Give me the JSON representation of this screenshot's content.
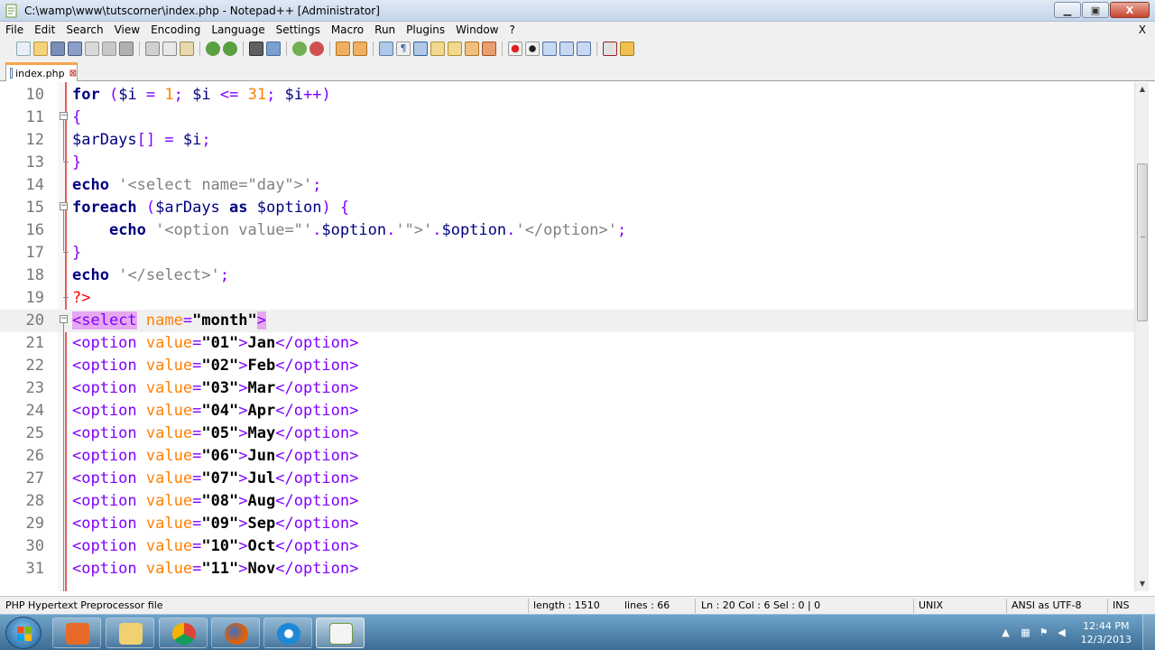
{
  "window": {
    "title": "C:\\wamp\\www\\tutscorner\\index.php - Notepad++ [Administrator]",
    "controls": {
      "minimize": "▁",
      "maximize": "▣",
      "close": "X"
    }
  },
  "menu": {
    "items": [
      "File",
      "Edit",
      "Search",
      "View",
      "Encoding",
      "Language",
      "Settings",
      "Macro",
      "Run",
      "Plugins",
      "Window",
      "?"
    ],
    "close_doc": "X"
  },
  "tab": {
    "label": "index.php",
    "close": "⊠"
  },
  "editor": {
    "lines": [
      {
        "n": "10"
      },
      {
        "n": "11"
      },
      {
        "n": "12"
      },
      {
        "n": "13"
      },
      {
        "n": "14"
      },
      {
        "n": "15"
      },
      {
        "n": "16"
      },
      {
        "n": "17"
      },
      {
        "n": "18"
      },
      {
        "n": "19"
      },
      {
        "n": "20"
      },
      {
        "n": "21"
      },
      {
        "n": "22"
      },
      {
        "n": "23"
      },
      {
        "n": "24"
      },
      {
        "n": "25"
      },
      {
        "n": "26"
      },
      {
        "n": "27"
      },
      {
        "n": "28"
      },
      {
        "n": "29"
      },
      {
        "n": "30"
      },
      {
        "n": "31"
      }
    ],
    "code": {
      "l10": {
        "kw": "for",
        "rest1": " (",
        "v": "$i",
        "op1": " = ",
        "num1": "1",
        "op2": "; ",
        "v2": "$i",
        "op3": " <= ",
        "num2": "31",
        "op4": "; ",
        "v3": "$i",
        "op5": "++)"
      },
      "l11": "{",
      "l12": {
        "v": "$arDays",
        "op": "[] = ",
        "v2": "$i",
        "semi": ";"
      },
      "l13": "}",
      "l14": {
        "kw": "echo",
        "sp": " ",
        "str": "'<select name=\"day\">'",
        "semi": ";"
      },
      "l15": {
        "kw": "foreach",
        "op1": " (",
        "v": "$arDays",
        "sp": " ",
        "kw2": "as",
        "sp2": " ",
        "v2": "$option",
        "op2": ") {"
      },
      "l16": {
        "indent": "    ",
        "kw": "echo",
        "sp": " ",
        "str1": "'<option value=\"'",
        "op1": ".",
        "v": "$option",
        "op2": ".",
        "str2": "'\">'",
        "op3": ".",
        "v2": "$option",
        "op4": ".",
        "str3": "'</option>'",
        "semi": ";"
      },
      "l17": "}",
      "l18": {
        "kw": "echo",
        "sp": " ",
        "str": "'</select>'",
        "semi": ";"
      },
      "l19": "?>",
      "l20": {
        "open": "<",
        "tag": "select",
        "sp": " ",
        "attr": "name",
        "eq": "=",
        "val": "\"month\"",
        "close": ">"
      },
      "options": [
        {
          "value": "\"01\"",
          "text": "Jan"
        },
        {
          "value": "\"02\"",
          "text": "Feb"
        },
        {
          "value": "\"03\"",
          "text": "Mar"
        },
        {
          "value": "\"04\"",
          "text": "Apr"
        },
        {
          "value": "\"05\"",
          "text": "May"
        },
        {
          "value": "\"06\"",
          "text": "Jun"
        },
        {
          "value": "\"07\"",
          "text": "Jul"
        },
        {
          "value": "\"08\"",
          "text": "Aug"
        },
        {
          "value": "\"09\"",
          "text": "Sep"
        },
        {
          "value": "\"10\"",
          "text": "Oct"
        },
        {
          "value": "\"11\"",
          "text": "Nov"
        }
      ],
      "opt_open": "<option",
      "opt_attr": " value",
      "opt_eq": "=",
      "opt_gt": ">",
      "opt_close": "</option>"
    }
  },
  "status": {
    "filetype": "PHP Hypertext Preprocessor file",
    "length": "length : 1510",
    "lines": "lines : 66",
    "position": "Ln : 20    Col : 6    Sel : 0 | 0",
    "eol": "UNIX",
    "encoding": "ANSI as UTF-8",
    "mode": "INS"
  },
  "taskbar": {
    "time": "12:44 PM",
    "date": "12/3/2013"
  },
  "colors": {
    "keyword": "#000080",
    "number": "#ff8000",
    "operator": "#8000ff",
    "string": "#808080",
    "tag_highlight": "#e6a8f0"
  }
}
